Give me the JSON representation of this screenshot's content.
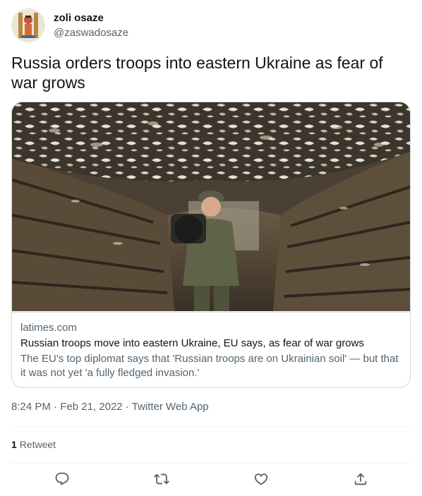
{
  "author": {
    "name": "zoli osaze",
    "handle": "@zaswadosaze"
  },
  "tweet": {
    "text": "Russia orders troops into eastern Ukraine as fear of war grows"
  },
  "card": {
    "domain": "latimes.com",
    "title": "Russian troops move into eastern Ukraine, EU says, as fear of war grows",
    "description": "The EU's top diplomat says that 'Russian troops are on Ukrainian soil' — but that it was not yet 'a fully fledged invasion.'"
  },
  "meta": {
    "time": "8:24 PM",
    "separator": "·",
    "date": "Feb 21, 2022",
    "source": "Twitter Web App"
  },
  "stats": {
    "retweet_count": "1",
    "retweet_label": "Retweet"
  },
  "actions": {
    "icons": [
      "reply-icon",
      "retweet-icon",
      "like-icon",
      "share-icon"
    ]
  },
  "colors": {
    "text_primary": "#0f1419",
    "text_secondary": "#536471",
    "border": "#cfd9de"
  }
}
